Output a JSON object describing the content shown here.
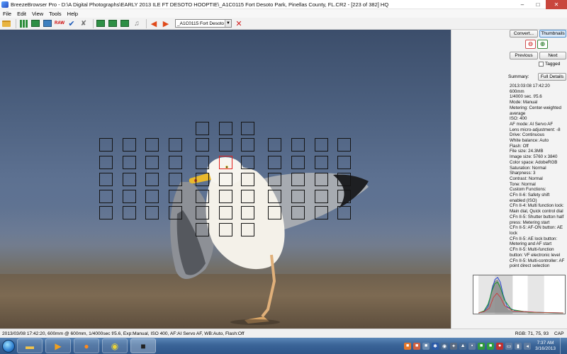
{
  "window": {
    "title": "BreezeBrowser Pro - D:\\A Digital Photographs\\EARLY 2013 ILE FT DESOTO HOOPTIE\\_A1C0115  Fort Desoto Park, Pinellas County, FL.CR2 - [223 of 382] HQ",
    "minimize": "–",
    "maximize": "□",
    "close": "✕"
  },
  "menu": [
    "File",
    "Edit",
    "View",
    "Tools",
    "Help"
  ],
  "toolbar": {
    "raw_label": "RAW",
    "file_select": "_A1C0115  Fort Desoto"
  },
  "panel": {
    "convert": "Convert...",
    "thumbnails": "Thumbnails",
    "previous": "Previous",
    "next": "Next",
    "tagged": "Tagged",
    "summary_label": "Summary:",
    "full_details": "Full Details",
    "exif": [
      "2013:03:08 17:42:20",
      "600mm",
      "1/4000 sec. f/5.6",
      "Mode: Manual",
      "Metering: Center-weighted average",
      "ISO: 400",
      "AF mode: AI Servo AF",
      "Lens micro-adjustment: -8",
      "Drive: Continuous",
      "White balance: Auto",
      "Flash: Off",
      "File size: 24.3MB",
      "Image size: 5760 x 3840",
      "Color space: AdobeRGB",
      "Saturation: Normal",
      "Sharpness: 3",
      "Contrast: Normal",
      "Tone: Normal",
      "Custom Functions:",
      "CFn II-6: Safety shift enabled (ISO)",
      "CFn II-4: Multi function lock: Main dial, Quick control dial",
      "CFn II-5: Shutter button half press: Metering start",
      "CFn II-5: AF-ON button: AE lock",
      "CFn II-5: AE lock button: Metering and AF start",
      "CFn II-5: Multi-function button: VF electronic level",
      "CFn II-5: Multi-controller: AF point direct selection"
    ]
  },
  "status": {
    "info": "2013/03/08 17:42:20, 600mm @ 600mm, 1/4000sec f/5.6, Exp:Manual, ISO 400, AF:AI Servo AF, WB:Auto, Flash:Off",
    "rgb": "RGB:  71, 75, 93",
    "cap": "CAP"
  },
  "taskbar": {
    "time": "7:37 AM",
    "date": "3/16/2013"
  },
  "colors": {
    "af_point": "#141414",
    "af_active": "#e0201c",
    "close": "#c9463d"
  }
}
